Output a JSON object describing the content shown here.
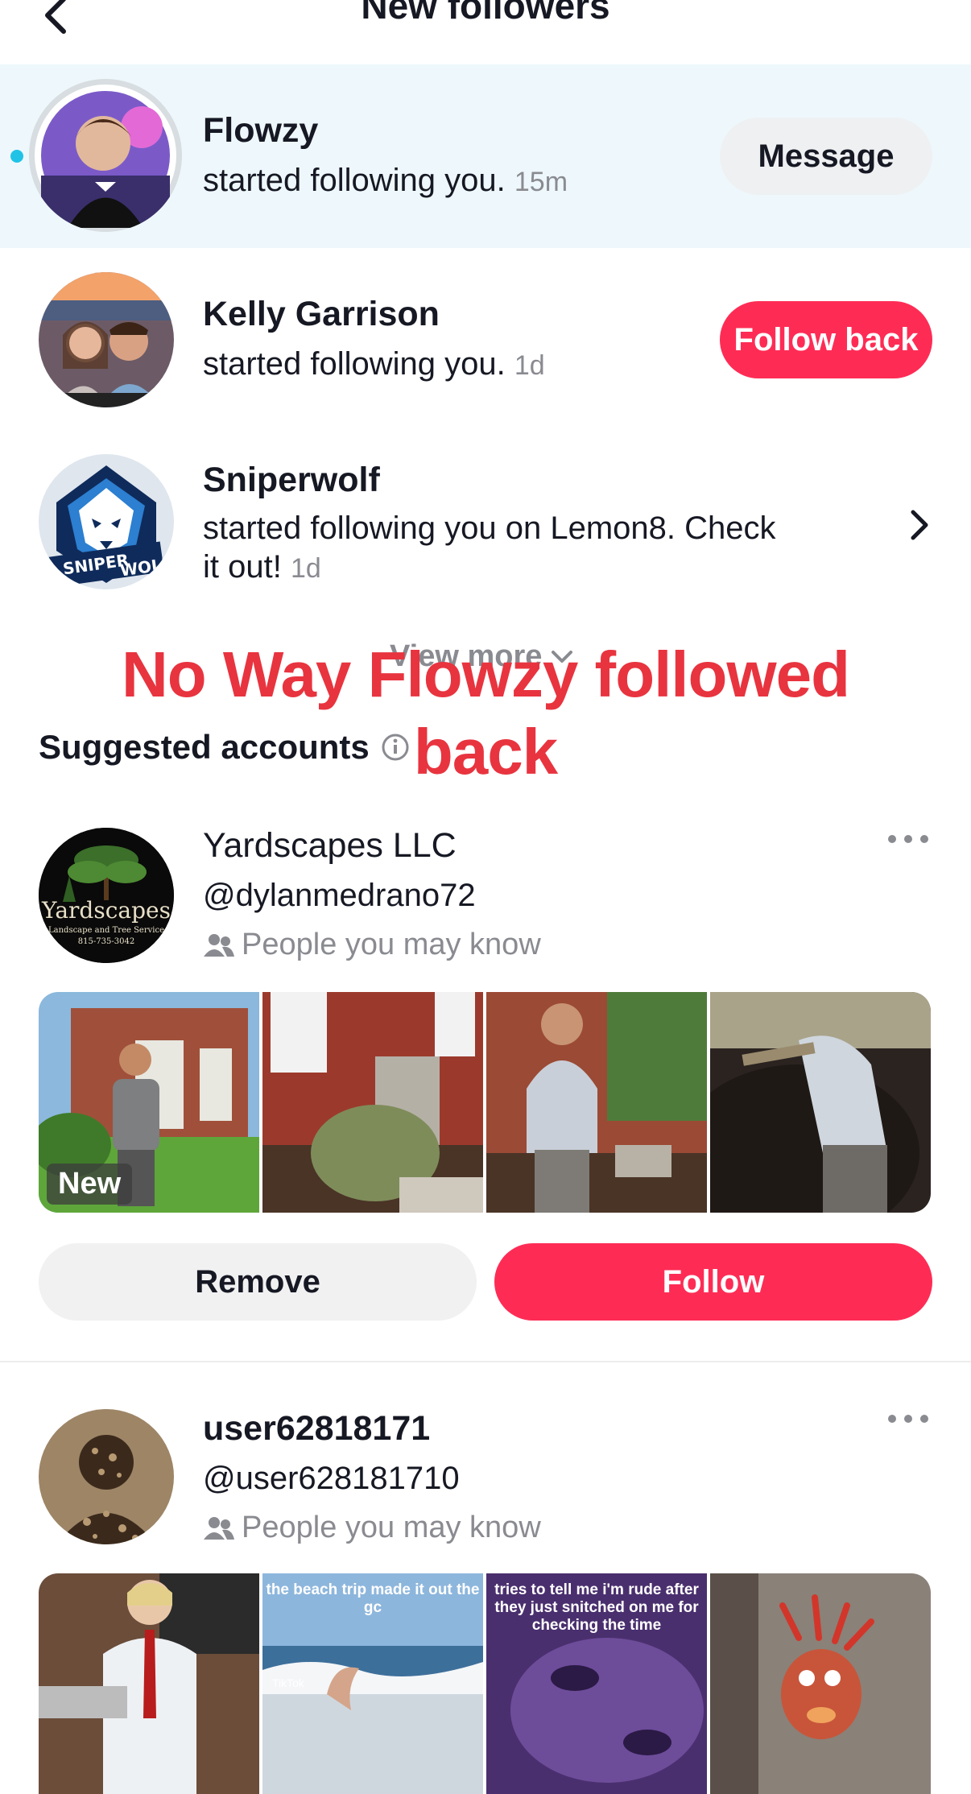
{
  "header": {
    "title": "New followers"
  },
  "followers": [
    {
      "name": "Flowzy",
      "text": "started following you.",
      "time": "15m",
      "button": "Message",
      "unread": true
    },
    {
      "name": "Kelly Garrison",
      "text": "started following you.",
      "time": "1d",
      "button": "Follow back"
    },
    {
      "name": "Sniperwolf",
      "text_line1": "started following you on Lemon8. Check",
      "text_line2": "it out!",
      "time": "1d",
      "avatar_text_1": "SNIPER",
      "avatar_text_2": "WOLF"
    }
  ],
  "view_more": "View more",
  "overlay_text": {
    "line1": "No Way Flowzy followed",
    "line2": "back"
  },
  "suggested": {
    "title": "Suggested accounts",
    "accounts": [
      {
        "name": "Yardscapes LLC",
        "handle": "@dylanmedrano72",
        "reason": "People you may know",
        "avatar_text": "Yardscapes",
        "avatar_sub": "Landscape and Tree Service",
        "avatar_phone": "815-735-3042",
        "new_badge": "New",
        "remove_label": "Remove",
        "follow_label": "Follow"
      },
      {
        "name": "user62818171",
        "handle": "@user628181710",
        "reason": "People you may know",
        "thumb_captions": [
          "the beach trip made it out the gc",
          "tries to tell me i'm rude after they just snitched on me for checking the time"
        ],
        "tiktok_label": "TikTok"
      }
    ]
  },
  "colors": {
    "accent": "#fe2c55",
    "unread": "#20c3e6",
    "highlight_bg": "#eef8fc",
    "overlay": "#e8343f"
  }
}
